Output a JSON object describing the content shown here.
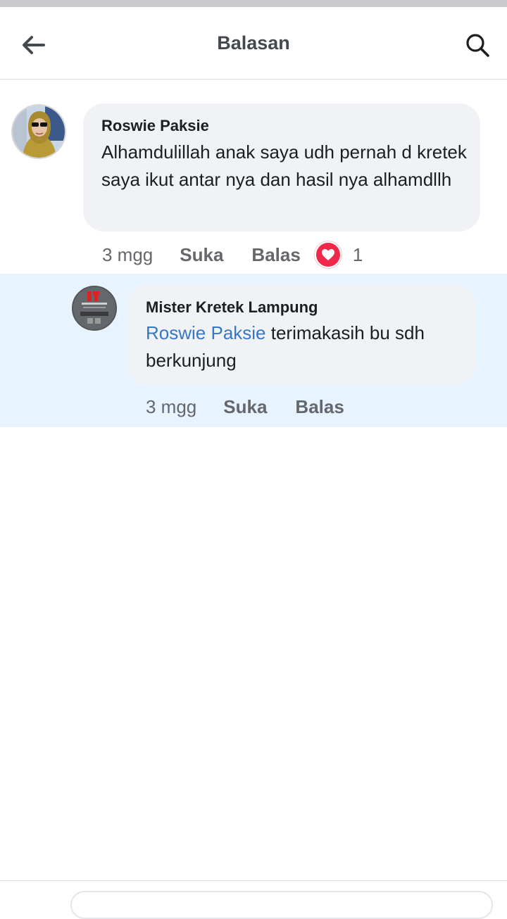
{
  "header": {
    "title": "Balasan"
  },
  "comments": [
    {
      "author": "Roswie Paksie",
      "text": "Alhamdulillah anak saya udh pernah d kretek  saya ikut antar nya dan hasil nya alhamdllh",
      "time": "3 mgg",
      "like_label": "Suka",
      "reply_label": "Balas",
      "reaction": "heart-reaction",
      "reaction_count": "1"
    },
    {
      "author": "Mister Kretek Lampung",
      "mention": "Roswie Paksie",
      "text": " terimakasih bu sdh berkunjung",
      "time": "3 mgg",
      "like_label": "Suka",
      "reply_label": "Balas"
    }
  ],
  "colors": {
    "highlight_bg": "#e7f3ff",
    "bubble_bg": "#f0f2f5",
    "mention": "#3578c6",
    "heart": "#f02849"
  }
}
